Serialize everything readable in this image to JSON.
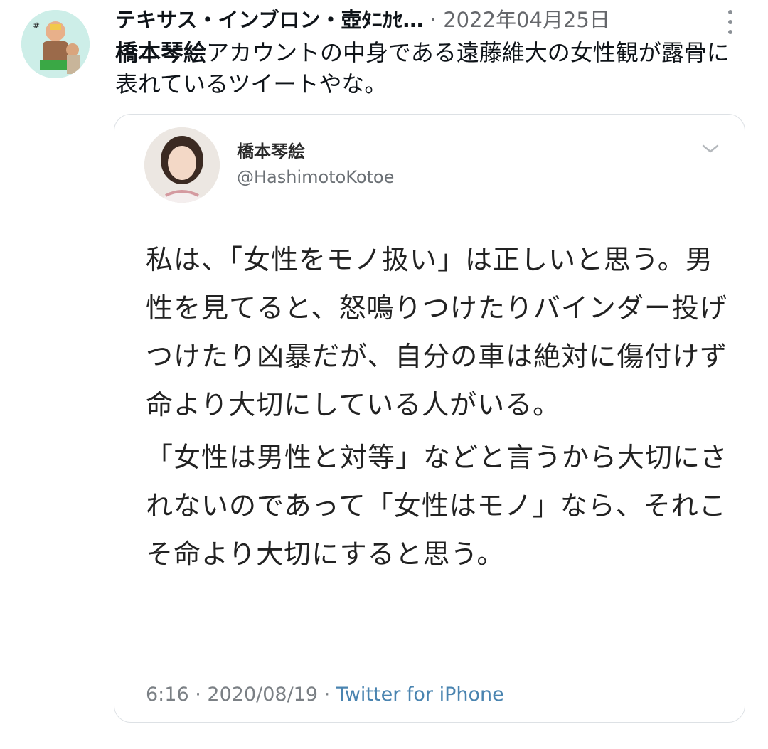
{
  "tweet": {
    "author_name": "テキサス・インブロン・壺ﾀﾆｶｾ…",
    "separator": "·",
    "date": "2022年04月25日",
    "body_highlight": "橋本琴絵",
    "body_rest": "アカウントの中身である遠藤維大の女性観が露骨に表れているツイートやな。"
  },
  "quote": {
    "name": "橋本琴絵",
    "handle": "@HashimotoKotoe",
    "paragraphs": [
      "私は、「女性をモノ扱い」は正しいと思う。男性を見てると、怒鳴りつけたりバインダー投げつけたり凶暴だが、自分の車は絶対に傷付けず命より大切にしている人がいる。",
      "「女性は男性と対等」などと言うから大切にされないのであって「女性はモノ」なら、それこそ命より大切にすると思う。"
    ],
    "time": "6:16",
    "sep1": "·",
    "date": "2020/08/19",
    "sep2": "·",
    "source": "Twitter for iPhone"
  },
  "icons": {
    "more": "more-vertical-icon",
    "chevron": "chevron-down-icon"
  },
  "colors": {
    "meta_gray": "#65676b",
    "link_blue": "#4a84b0",
    "card_border": "#dde1e5"
  }
}
